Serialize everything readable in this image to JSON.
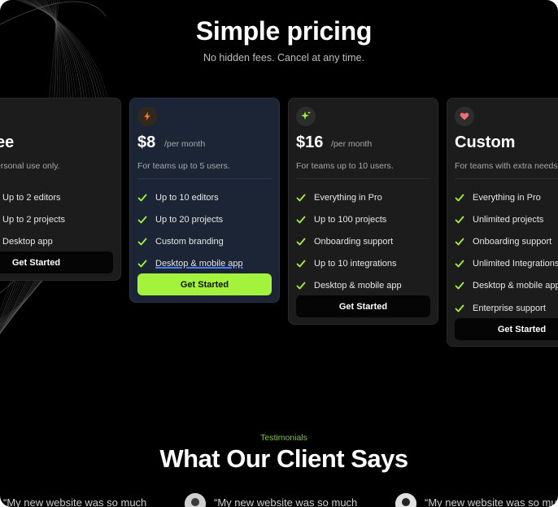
{
  "header": {
    "title": "Simple pricing",
    "subtitle": "No hidden fees. Cancel at any time."
  },
  "colors": {
    "accent": "#a3f33d",
    "background": "#000000",
    "card": "#1c1c1c",
    "card_highlight": "#1c2536"
  },
  "plans": [
    {
      "icon": "sparkle-icon",
      "price": "ee",
      "period": "",
      "description": "ersonal use only.",
      "features": [
        "Up to 2 editors",
        "Up to 2 projects",
        "Desktop app"
      ],
      "cta": "Get Started"
    },
    {
      "icon": "bolt-icon",
      "price": "$8",
      "period": "/per month",
      "description": "For teams up to 5 users.",
      "features": [
        "Up to 10 editors",
        "Up to 20 projects",
        "Custom branding",
        "Desktop & mobile app"
      ],
      "cta": "Get Started"
    },
    {
      "icon": "sparkle-icon",
      "price": "$16",
      "period": "/per month",
      "description": "For teams up to 10 users.",
      "features": [
        "Everything in Pro",
        "Up to 100 projects",
        "Onboarding support",
        "Up to 10 integrations",
        "Desktop & mobile app"
      ],
      "cta": "Get Started"
    },
    {
      "icon": "heart-icon",
      "price": "Custom",
      "period": "",
      "description": "For teams with extra needs.",
      "features": [
        "Everything in Pro",
        "Unlimited projects",
        "Onboarding support",
        "Unlimited Integrations",
        "Desktop & mobile app",
        "Enterprise support"
      ],
      "cta": "Get Started"
    }
  ],
  "testimonials": {
    "eyebrow": "Testimonials",
    "heading": "What Our Client Says",
    "quotes": [
      "“My new website was so much",
      "“My new website was so much",
      "“My new website was so much"
    ]
  }
}
